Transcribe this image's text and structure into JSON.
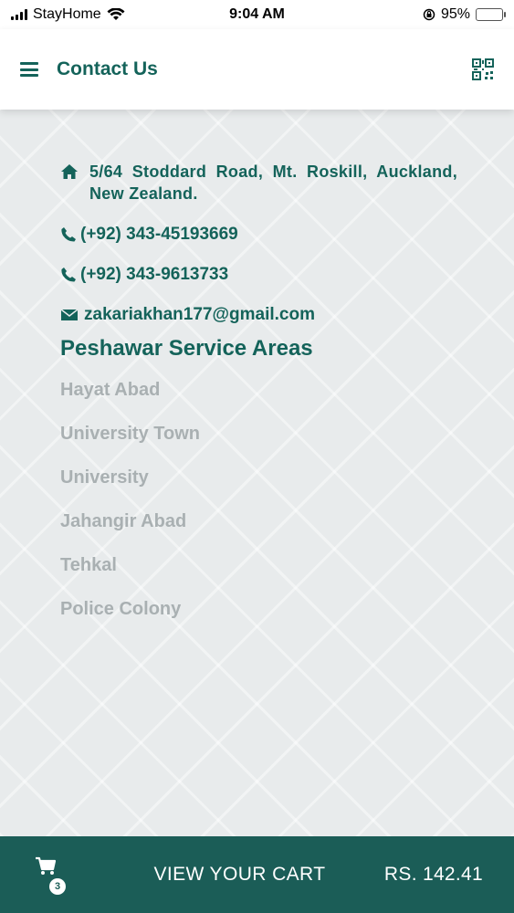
{
  "status_bar": {
    "carrier": "StayHome",
    "time": "9:04 AM",
    "battery_percent": "95%",
    "battery_level": 0.95,
    "battery_color": "#f2c200"
  },
  "header": {
    "title": "Contact Us",
    "menu_icon": "hamburger-menu-icon",
    "qr_icon": "qr-code-icon"
  },
  "contact": {
    "address": "5/64 Stoddard Road, Mt. Roskill, Auckland, New Zealand.",
    "phones": [
      "(+92) 343-45193669",
      "(+92) 343-9613733"
    ],
    "email": "zakariakhan177@gmail.com"
  },
  "service_areas": {
    "title": "Peshawar Service Areas",
    "items": [
      "Hayat Abad",
      "University Town",
      "University",
      "Jahangir Abad",
      "Tehkal",
      "Police Colony"
    ]
  },
  "cart": {
    "count": "3",
    "label": "VIEW YOUR CART",
    "total": "RS. 142.41"
  },
  "colors": {
    "accent": "#14635a",
    "cart_bar": "#1b5d57",
    "area_text": "#a9b0b2"
  }
}
